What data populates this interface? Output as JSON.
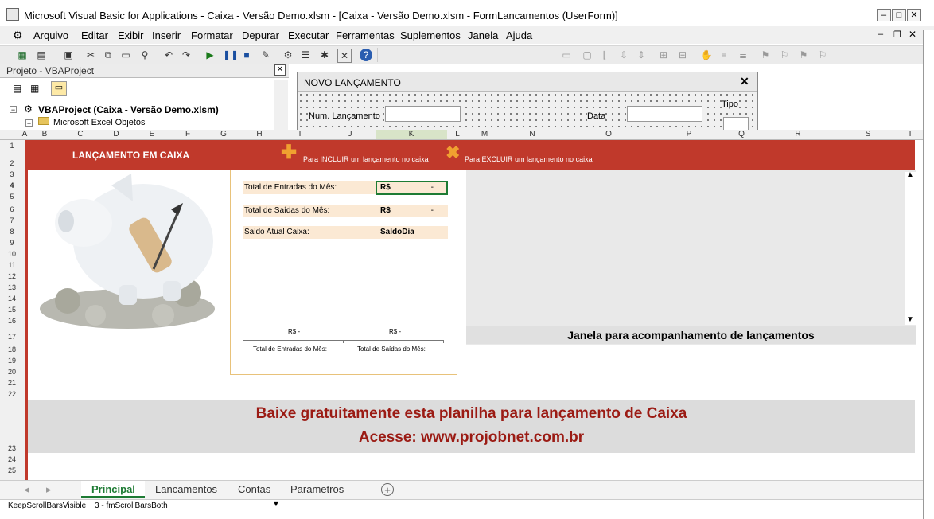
{
  "window": {
    "title": "Microsoft Visual Basic for Applications - Caixa - Versão Demo.xlsm - [Caixa - Versão Demo.xlsm - FormLancamentos (UserForm)]"
  },
  "menu": [
    "Arquivo",
    "Editar",
    "Exibir",
    "Inserir",
    "Formatar",
    "Depurar",
    "Executar",
    "Ferramentas",
    "Suplementos",
    "Janela",
    "Ajuda"
  ],
  "project": {
    "pane_title": "Projeto - VBAProject",
    "root": "VBAProject (Caixa - Versão Demo.xlsm)",
    "child": "Microsoft Excel Objetos"
  },
  "userform": {
    "title": "NOVO LANÇAMENTO",
    "num_label": "Num. Lançamento",
    "data_label": "Data",
    "tipo_label": "Tipo"
  },
  "columns": [
    "A",
    "B",
    "C",
    "D",
    "E",
    "F",
    "G",
    "H",
    "I",
    "J",
    "K",
    "L",
    "M",
    "N",
    "O",
    "P",
    "Q",
    "R",
    "S",
    "T"
  ],
  "rows": [
    "1",
    "2",
    "3",
    "4",
    "5",
    "6",
    "7",
    "8",
    "9",
    "10",
    "11",
    "12",
    "13",
    "14",
    "15",
    "16",
    "17",
    "18",
    "19",
    "20",
    "21",
    "22",
    "23",
    "24",
    "25"
  ],
  "sheet": {
    "banner_title": "LANÇAMENTO EM CAIXA",
    "include_label": "Para INCLUIR um lançamento no caixa",
    "exclude_label": "Para EXCLUIR um lançamento no caixa",
    "summary": [
      {
        "label": "Total de Entradas do Mês:",
        "value": "R$",
        "dash": "-"
      },
      {
        "label": "Total de Saídas do Mês:",
        "value": "R$",
        "dash": "-"
      },
      {
        "label": "Saldo Atual Caixa:",
        "value": "SaldoDia",
        "dash": ""
      }
    ],
    "mini_chart": {
      "left_value": "R$ -",
      "right_value": "R$ -",
      "left_label": "Total de Entradas do Mês:",
      "right_label": "Total de Saídas do Mês:"
    },
    "tracker_label": "Janela para acompanhamento de lançamentos",
    "promo_line1": "Baixe gratuitamente esta planilha para lançamento de Caixa",
    "promo_line2": "Acesse: www.projobnet.com.br"
  },
  "tabs": [
    "Principal",
    "Lancamentos",
    "Contas",
    "Parametros"
  ],
  "propbar": {
    "value": "KeepScrollBarsVisible",
    "option": "3 - fmScrollBarsBoth"
  },
  "colors": {
    "banner": "#c0392b",
    "promo_text": "#9b1b14",
    "summary_row": "#fbe9d4"
  }
}
